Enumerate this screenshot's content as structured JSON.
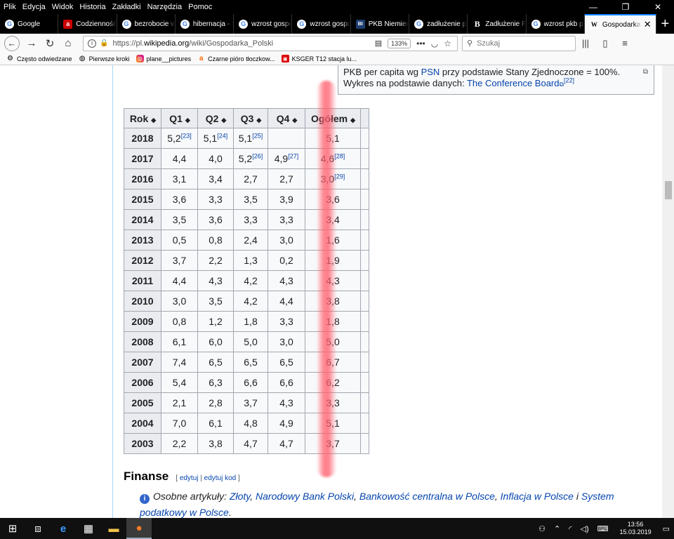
{
  "menubar": {
    "items": [
      "Plik",
      "Edycja",
      "Widok",
      "Historia",
      "Zakładki",
      "Narzędzia",
      "Pomoc"
    ],
    "minimize": "—",
    "maximize": "❐",
    "close": "✕"
  },
  "tabs": [
    {
      "title": "Google",
      "icon": "G"
    },
    {
      "title": "Codzienność",
      "icon": "a"
    },
    {
      "title": "bezrobocie w",
      "icon": "G"
    },
    {
      "title": "hibernacja - S",
      "icon": "G"
    },
    {
      "title": "wzrost gospo",
      "icon": "G"
    },
    {
      "title": "wzrost gospo",
      "icon": "G"
    },
    {
      "title": "PKB Niemiec",
      "icon": "BI"
    },
    {
      "title": "zadłużenie pe",
      "icon": "G"
    },
    {
      "title": "Zadłużenie P",
      "icon": "B"
    },
    {
      "title": "wzrost pkb pe",
      "icon": "G"
    },
    {
      "title": "Gospodarka",
      "icon": "W",
      "close": "✕"
    }
  ],
  "newtab": "+",
  "nav": {
    "url_prefix": "https://pl.",
    "url_domain": "wikipedia.org",
    "url_path": "/wiki/Gospodarka_Polski",
    "zoom": "133%",
    "search_placeholder": "Szukaj",
    "menu_dots": "•••"
  },
  "bookmarks": [
    {
      "label": "Często odwiedzane",
      "icon": "gear-icon"
    },
    {
      "label": "Pierwsze kroki",
      "icon": "globe-icon"
    },
    {
      "label": "plane__pictures",
      "icon": "instagram-icon"
    },
    {
      "label": "Czarne pióro tłoczkow...",
      "icon": "allegro-icon"
    },
    {
      "label": "KSGER T12 stacja lu...",
      "icon": "aliexpress-icon"
    }
  ],
  "infobox": {
    "line1_pre": "PKB per capita wg ",
    "line1_link": "PSN",
    "line1_post": " przy podstawie Stany Zjednoczone = 100%.",
    "line2_pre": "Wykres na podstawie danych: ",
    "line2_link": "The Conference Board",
    "line2_ref": "[22]"
  },
  "table": {
    "headers": [
      "Rok",
      "Q1",
      "Q2",
      "Q3",
      "Q4",
      "Ogółem"
    ],
    "rows": [
      {
        "year": "2018",
        "q1": "5,2",
        "q1r": "[23]",
        "q2": "5,1",
        "q2r": "[24]",
        "q3": "5,1",
        "q3r": "[25]",
        "q4": "",
        "q4r": "",
        "tot": "5,1",
        "totr": ""
      },
      {
        "year": "2017",
        "q1": "4,4",
        "q1r": "",
        "q2": "4,0",
        "q2r": "",
        "q3": "5,2",
        "q3r": "[26]",
        "q4": "4,9",
        "q4r": "[27]",
        "tot": "4,6",
        "totr": "[28]"
      },
      {
        "year": "2016",
        "q1": "3,1",
        "q1r": "",
        "q2": "3,4",
        "q2r": "",
        "q3": "2,7",
        "q3r": "",
        "q4": "2,7",
        "q4r": "",
        "tot": "3,0",
        "totr": "[29]"
      },
      {
        "year": "2015",
        "q1": "3,6",
        "q1r": "",
        "q2": "3,3",
        "q2r": "",
        "q3": "3,5",
        "q3r": "",
        "q4": "3,9",
        "q4r": "",
        "tot": "3,6",
        "totr": ""
      },
      {
        "year": "2014",
        "q1": "3,5",
        "q1r": "",
        "q2": "3,6",
        "q2r": "",
        "q3": "3,3",
        "q3r": "",
        "q4": "3,3",
        "q4r": "",
        "tot": "3,4",
        "totr": ""
      },
      {
        "year": "2013",
        "q1": "0,5",
        "q1r": "",
        "q2": "0,8",
        "q2r": "",
        "q3": "2,4",
        "q3r": "",
        "q4": "3,0",
        "q4r": "",
        "tot": "1,6",
        "totr": ""
      },
      {
        "year": "2012",
        "q1": "3,7",
        "q1r": "",
        "q2": "2,2",
        "q2r": "",
        "q3": "1,3",
        "q3r": "",
        "q4": "0,2",
        "q4r": "",
        "tot": "1,9",
        "totr": ""
      },
      {
        "year": "2011",
        "q1": "4,4",
        "q1r": "",
        "q2": "4,3",
        "q2r": "",
        "q3": "4,2",
        "q3r": "",
        "q4": "4,3",
        "q4r": "",
        "tot": "4,3",
        "totr": ""
      },
      {
        "year": "2010",
        "q1": "3,0",
        "q1r": "",
        "q2": "3,5",
        "q2r": "",
        "q3": "4,2",
        "q3r": "",
        "q4": "4,4",
        "q4r": "",
        "tot": "3,8",
        "totr": ""
      },
      {
        "year": "2009",
        "q1": "0,8",
        "q1r": "",
        "q2": "1,2",
        "q2r": "",
        "q3": "1,8",
        "q3r": "",
        "q4": "3,3",
        "q4r": "",
        "tot": "1,8",
        "totr": ""
      },
      {
        "year": "2008",
        "q1": "6,1",
        "q1r": "",
        "q2": "6,0",
        "q2r": "",
        "q3": "5,0",
        "q3r": "",
        "q4": "3,0",
        "q4r": "",
        "tot": "5,0",
        "totr": ""
      },
      {
        "year": "2007",
        "q1": "7,4",
        "q1r": "",
        "q2": "6,5",
        "q2r": "",
        "q3": "6,5",
        "q3r": "",
        "q4": "6,5",
        "q4r": "",
        "tot": "6,7",
        "totr": ""
      },
      {
        "year": "2006",
        "q1": "5,4",
        "q1r": "",
        "q2": "6,3",
        "q2r": "",
        "q3": "6,6",
        "q3r": "",
        "q4": "6,6",
        "q4r": "",
        "tot": "6,2",
        "totr": ""
      },
      {
        "year": "2005",
        "q1": "2,1",
        "q1r": "",
        "q2": "2,8",
        "q2r": "",
        "q3": "3,7",
        "q3r": "",
        "q4": "4,3",
        "q4r": "",
        "tot": "3,3",
        "totr": ""
      },
      {
        "year": "2004",
        "q1": "7,0",
        "q1r": "",
        "q2": "6,1",
        "q2r": "",
        "q3": "4,8",
        "q3r": "",
        "q4": "4,9",
        "q4r": "",
        "tot": "5,1",
        "totr": ""
      },
      {
        "year": "2003",
        "q1": "2,2",
        "q1r": "",
        "q2": "3,8",
        "q2r": "",
        "q3": "4,7",
        "q3r": "",
        "q4": "4,7",
        "q4r": "",
        "tot": "3,7",
        "totr": ""
      }
    ]
  },
  "section": {
    "title": "Finanse",
    "edit": "edytuj",
    "sep": " | ",
    "edit_source": "edytuj kod",
    "bracket_open": "[ ",
    "bracket_close": " ]"
  },
  "hatnote": {
    "prefix": "Osobne artykuły: ",
    "links": [
      "Złoty",
      "Narodowy Bank Polski",
      "Bankowość centralna w Polsce",
      "Inflacja w Polsce"
    ],
    "and": " i ",
    "last": "System podatkowy w Polsce",
    "end": "."
  },
  "taskbar": {
    "time": "13:56",
    "date": "15.03.2019"
  },
  "colors": {
    "link": "#0645ad",
    "highlight": "#ff5f6e",
    "header_bg": "#eaecf0"
  }
}
